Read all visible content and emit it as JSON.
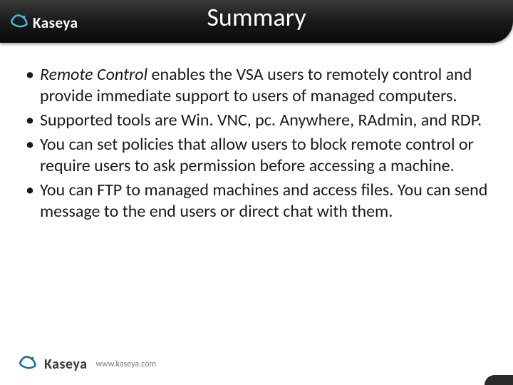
{
  "header": {
    "brand_name": "Kaseya",
    "title": "Summary"
  },
  "bullets": [
    {
      "emphasis": "Remote Control",
      "rest": " enables the VSA users to remotely control and provide immediate support to users of managed computers."
    },
    {
      "emphasis": "",
      "rest": "Supported tools are Win. VNC, pc. Anywhere, RAdmin, and RDP."
    },
    {
      "emphasis": "",
      "rest": "You can set policies that allow users to block remote control or require users to ask permission before accessing a machine."
    },
    {
      "emphasis": "",
      "rest": "You can FTP to managed machines and access files. You can send message to the end users or direct chat with them."
    }
  ],
  "footer": {
    "brand_name": "Kaseya",
    "url": "www.kaseya.com"
  }
}
